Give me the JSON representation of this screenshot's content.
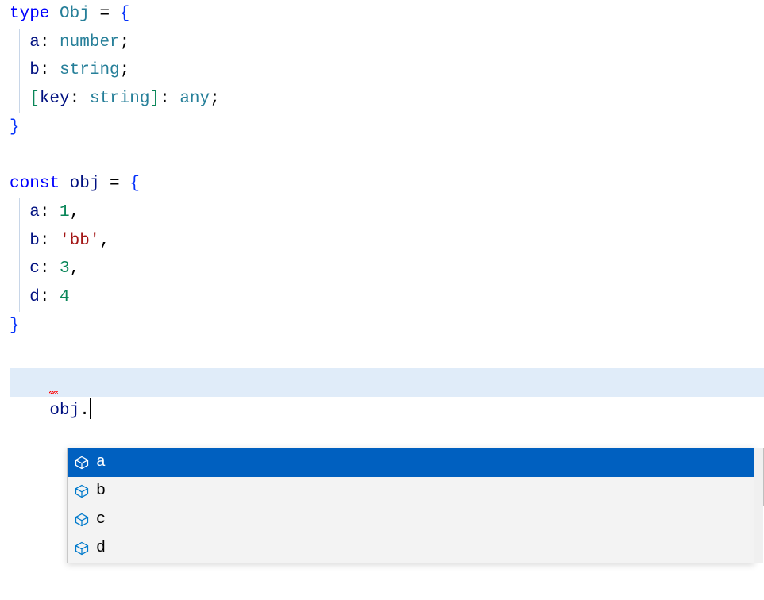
{
  "code": {
    "l1": {
      "kw": "type",
      "name": "Obj",
      "eq": " = ",
      "brace": "{"
    },
    "l2": {
      "prop": "a",
      "colon": ": ",
      "type": "number",
      "semi": ";"
    },
    "l3": {
      "prop": "b",
      "colon": ": ",
      "type": "string",
      "semi": ";"
    },
    "l4": {
      "lb": "[",
      "key": "key",
      "colon1": ": ",
      "keytype": "string",
      "rb": "]",
      "colon2": ": ",
      "anytype": "any",
      "semi": ";"
    },
    "l5": {
      "brace": "}"
    },
    "l7": {
      "kw": "const",
      "name": "obj",
      "eq": " = ",
      "brace": "{"
    },
    "l8": {
      "prop": "a",
      "colon": ": ",
      "val": "1",
      "comma": ","
    },
    "l9": {
      "prop": "b",
      "colon": ": ",
      "val": "'bb'",
      "comma": ","
    },
    "l10": {
      "prop": "c",
      "colon": ": ",
      "val": "3",
      "comma": ","
    },
    "l11": {
      "prop": "d",
      "colon": ": ",
      "val": "4"
    },
    "l12": {
      "brace": "}"
    },
    "cur": {
      "obj": "obj",
      "dot": "."
    }
  },
  "autocomplete": {
    "items": [
      {
        "label": "a"
      },
      {
        "label": "b"
      },
      {
        "label": "c"
      },
      {
        "label": "d"
      }
    ],
    "selectedIndex": 0
  }
}
